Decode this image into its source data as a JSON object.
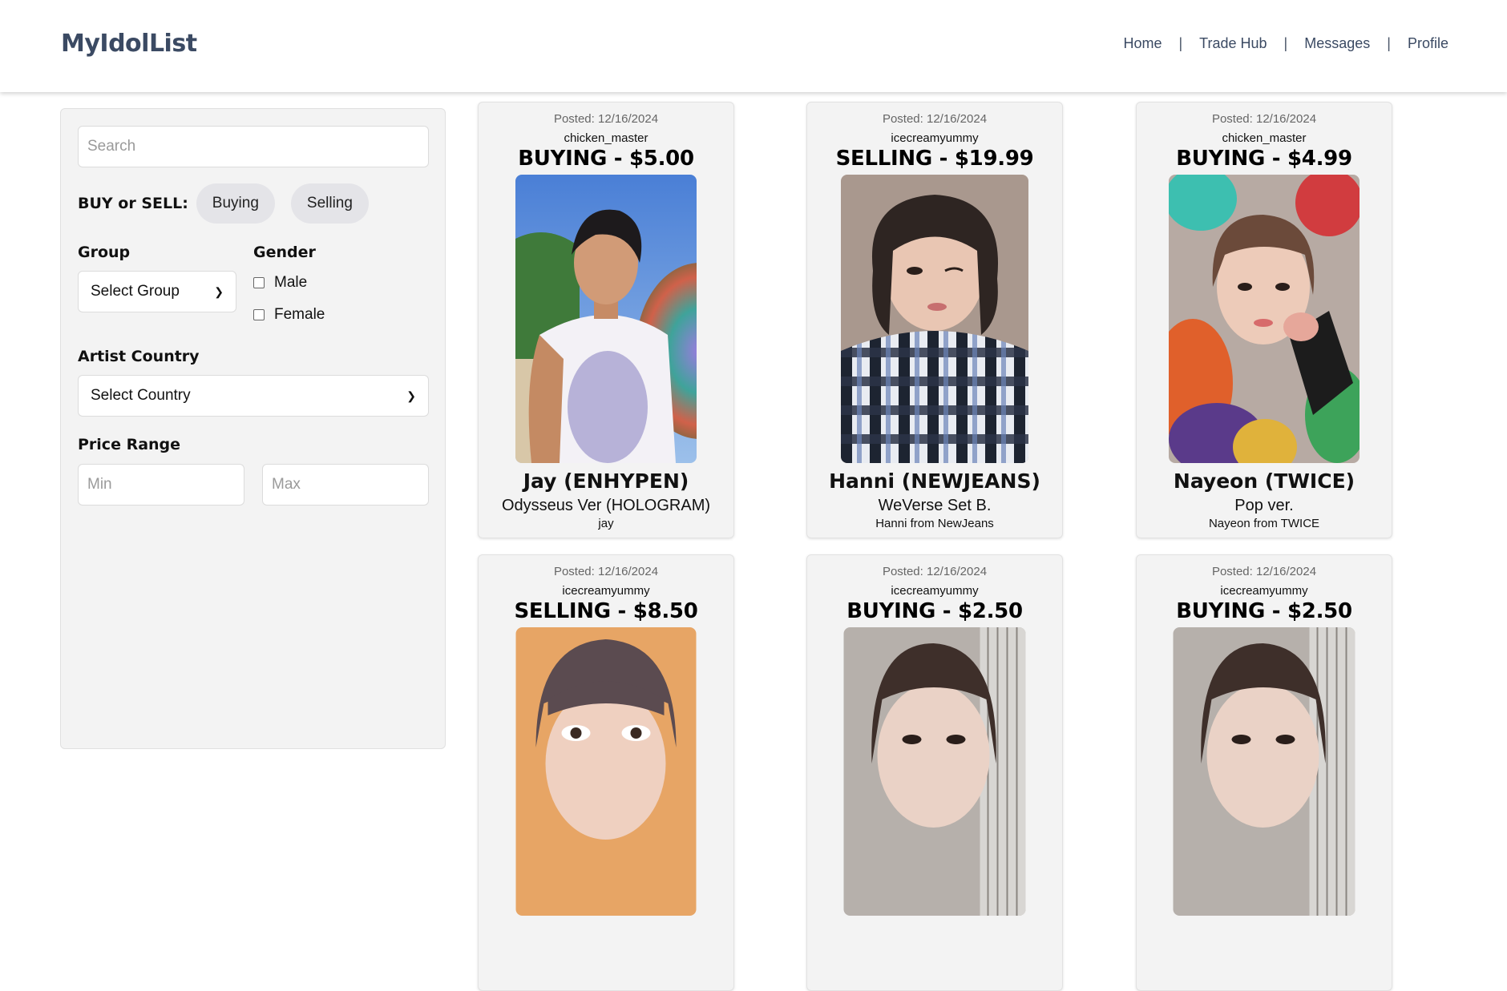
{
  "header": {
    "brand": "MyIdolList",
    "nav": [
      "Home",
      "Trade Hub",
      "Messages",
      "Profile"
    ],
    "separator": "|"
  },
  "filters": {
    "search_placeholder": "Search",
    "buy_sell_label": "BUY or SELL:",
    "buying_label": "Buying",
    "selling_label": "Selling",
    "group_label": "Group",
    "group_selected": "Select Group",
    "gender_label": "Gender",
    "gender_options": [
      "Male",
      "Female"
    ],
    "country_label": "Artist Country",
    "country_selected": "Select Country",
    "price_label": "Price Range",
    "min_placeholder": "Min",
    "max_placeholder": "Max"
  },
  "listings": [
    {
      "posted": "Posted: 12/16/2024",
      "user": "chicken_master",
      "price": "BUYING - $5.00",
      "name": "Jay (ENHYPEN)",
      "version": "Odysseus Ver (HOLOGRAM)",
      "desc": "jay"
    },
    {
      "posted": "Posted: 12/16/2024",
      "user": "icecreamyummy",
      "price": "SELLING - $19.99",
      "name": "Hanni (NEWJEANS)",
      "version": "WeVerse Set B.",
      "desc": "Hanni from NewJeans"
    },
    {
      "posted": "Posted: 12/16/2024",
      "user": "chicken_master",
      "price": "BUYING - $4.99",
      "name": "Nayeon (TWICE)",
      "version": "Pop ver.",
      "desc": "Nayeon from TWICE"
    },
    {
      "posted": "Posted: 12/16/2024",
      "user": "icecreamyummy",
      "price": "SELLING - $8.50"
    },
    {
      "posted": "Posted: 12/16/2024",
      "user": "icecreamyummy",
      "price": "BUYING - $2.50"
    },
    {
      "posted": "Posted: 12/16/2024",
      "user": "icecreamyummy",
      "price": "BUYING - $2.50"
    }
  ]
}
